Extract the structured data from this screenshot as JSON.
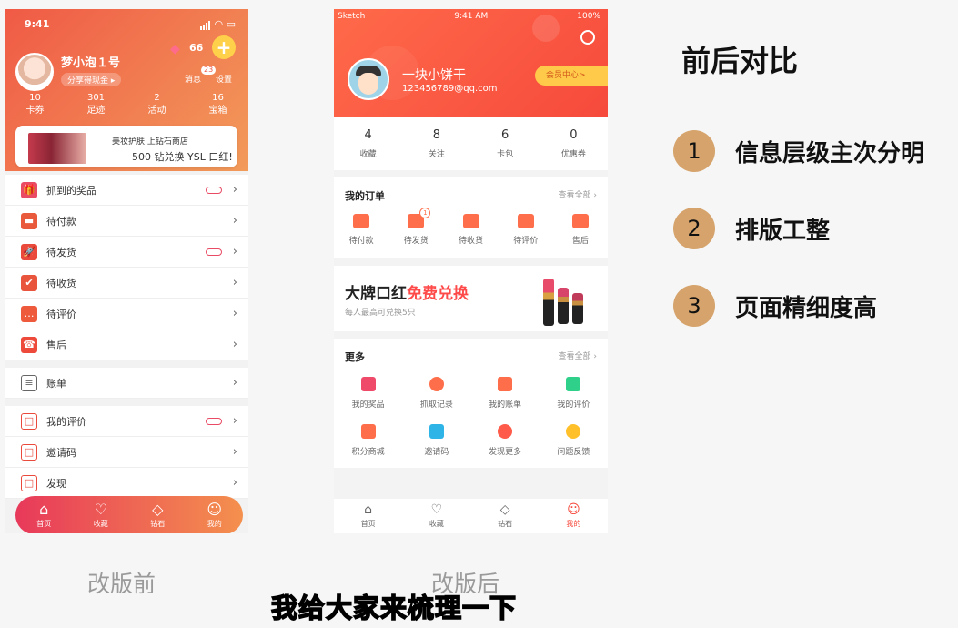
{
  "old": {
    "status_time": "9:41",
    "username": "梦小泡１号",
    "share_label": "分享得现金 ▸",
    "gem_count": "66",
    "msg_label": "消息",
    "msg_badge": "23",
    "settings_label": "设置",
    "stats": [
      {
        "n": "10",
        "l": "卡券"
      },
      {
        "n": "301",
        "l": "足迹"
      },
      {
        "n": "2",
        "l": "活动"
      },
      {
        "n": "16",
        "l": "宝箱"
      }
    ],
    "banner_line1": "美妆护肤 上钻石商店",
    "banner_line2": "500 钻兑换 YSL 口红!",
    "rows": [
      {
        "label": "抓到的奖品",
        "color": "#e94a64",
        "glyph": "🎁",
        "pill": true
      },
      {
        "label": "待付款",
        "color": "#e95a3c",
        "glyph": "▬",
        "pill": false
      },
      {
        "label": "待发货",
        "color": "#e94a3c",
        "glyph": "🚀",
        "pill": true
      },
      {
        "label": "待收货",
        "color": "#e9543c",
        "glyph": "✔",
        "pill": false
      },
      {
        "label": "待评价",
        "color": "#ee5a3c",
        "glyph": "…",
        "pill": false
      },
      {
        "label": "售后",
        "color": "#ee4a3c",
        "glyph": "☎",
        "pill": false
      }
    ],
    "bill_label": "账单",
    "rows2": [
      {
        "label": "我的评价",
        "pill": true
      },
      {
        "label": "邀请码",
        "pill": false
      },
      {
        "label": "发现",
        "pill": false
      }
    ],
    "tabs": [
      "首页",
      "收藏",
      "钻石",
      "我的"
    ]
  },
  "new": {
    "carrier": "Sketch",
    "status_time": "9:41 AM",
    "battery": "100%",
    "username": "一块小饼干",
    "email": "123456789@qq.com",
    "vip_label": "会员中心>",
    "stats": [
      {
        "n": "4",
        "l": "收藏"
      },
      {
        "n": "8",
        "l": "关注"
      },
      {
        "n": "6",
        "l": "卡包"
      },
      {
        "n": "0",
        "l": "优惠券"
      }
    ],
    "orders_title": "我的订单",
    "view_all": "查看全部",
    "orders": [
      {
        "label": "待付款",
        "badge": ""
      },
      {
        "label": "待发货",
        "badge": "1"
      },
      {
        "label": "待收货",
        "badge": ""
      },
      {
        "label": "待评价",
        "badge": ""
      },
      {
        "label": "售后",
        "badge": ""
      }
    ],
    "promo_title_a": "大牌口红",
    "promo_title_b": "免费兑换",
    "promo_sub": "每人最高可兑换5只",
    "more_title": "更多",
    "more_view_all": "查看全部",
    "more_items": [
      {
        "label": "我的奖品",
        "color": "#f04a6a"
      },
      {
        "label": "抓取记录",
        "color": "#ff6e4a"
      },
      {
        "label": "我的账单",
        "color": "#ff6e4a"
      },
      {
        "label": "我的评价",
        "color": "#2fd08a"
      },
      {
        "label": "积分商城",
        "color": "#ff6e4a"
      },
      {
        "label": "邀请码",
        "color": "#2fb4e8"
      },
      {
        "label": "发现更多",
        "color": "#ff5a4a"
      },
      {
        "label": "问题反馈",
        "color": "#ffc02a"
      }
    ],
    "tabs": [
      "首页",
      "收藏",
      "钻石",
      "我的"
    ]
  },
  "right": {
    "title": "前后对比",
    "points": [
      {
        "num": "1",
        "text": "信息层级主次分明"
      },
      {
        "num": "2",
        "text": "排版工整"
      },
      {
        "num": "3",
        "text": "页面精细度高"
      }
    ]
  },
  "captions": {
    "before": "改版前",
    "after": "改版后",
    "subtitle": "我给大家来梳理一下"
  }
}
